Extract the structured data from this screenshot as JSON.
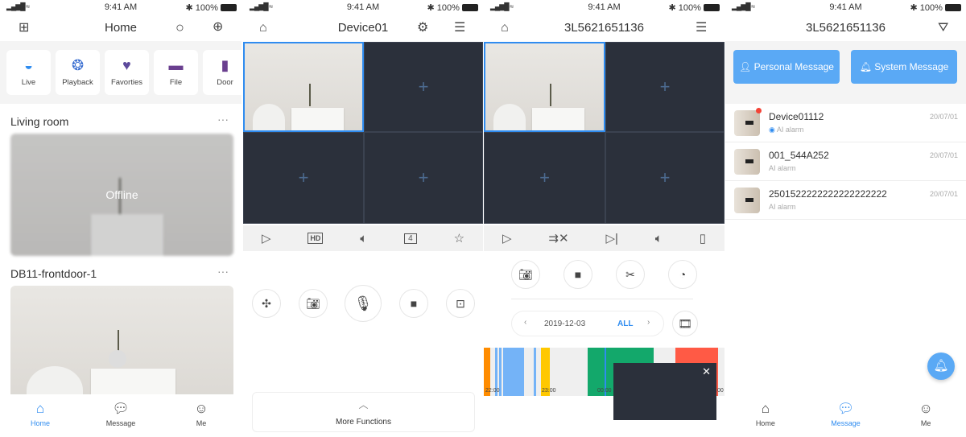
{
  "status_bar": {
    "time": "9:41 AM",
    "battery": "100%"
  },
  "home": {
    "title": "Home",
    "shortcuts": [
      {
        "label": "Live",
        "icon": "camera-icon",
        "color": "#2f8cf0"
      },
      {
        "label": "Playback",
        "icon": "playback-icon",
        "color": "#3b6fd1"
      },
      {
        "label": "Favorties",
        "icon": "heart-icon",
        "color": "#5d4a9c"
      },
      {
        "label": "File",
        "icon": "folder-icon",
        "color": "#6a3f8f"
      },
      {
        "label": "Door",
        "icon": "door-icon",
        "color": "#6a3f8f"
      }
    ],
    "groups": [
      {
        "name": "Living room",
        "overlay": "Offline"
      },
      {
        "name": "DB11-frontdoor-1"
      }
    ],
    "more": "···"
  },
  "tabs": [
    {
      "label": "Home"
    },
    {
      "label": "Message"
    },
    {
      "label": "Me"
    }
  ],
  "device": {
    "title": "Device01",
    "toolbar": [
      "play-icon",
      "hd-icon",
      "volume-icon",
      "split-4-icon",
      "star-icon"
    ],
    "hd": "HD",
    "split": "4",
    "controls": [
      "ptz-icon",
      "snapshot-icon",
      "microphone-icon",
      "record-icon",
      "fisheye-icon"
    ],
    "more_functions": "More Functions"
  },
  "playback": {
    "title": "3L5621651136",
    "toolbar": [
      "play-icon",
      "stop-all-icon",
      "step-icon",
      "volume-icon",
      "rotate-icon"
    ],
    "controls": [
      "snapshot-icon",
      "record-icon",
      "clip-icon",
      "speed-icon"
    ],
    "date": "2019-12-03",
    "filter": "ALL",
    "timeline": {
      "labels": [
        "22:00",
        "23:00",
        "00:00",
        "…00"
      ],
      "segment_colors": {
        "orange": "#ff8c00",
        "blue": "#74b3f7",
        "yellow": "#ffc800",
        "green": "#13a86b",
        "red": "#ff5a45"
      }
    }
  },
  "messages": {
    "title": "3L5621651136",
    "personal": "Personal Message",
    "system": "System Message",
    "accent": "#5aa9f5",
    "items": [
      {
        "name": "Device01112",
        "type": "AI alarm",
        "date": "20/07/01",
        "unread": true
      },
      {
        "name": "001_544A252",
        "type": "AI alarm",
        "date": "20/07/01"
      },
      {
        "name": "2501522222222222222222",
        "type": "AI alarm",
        "date": "20/07/01"
      }
    ]
  }
}
